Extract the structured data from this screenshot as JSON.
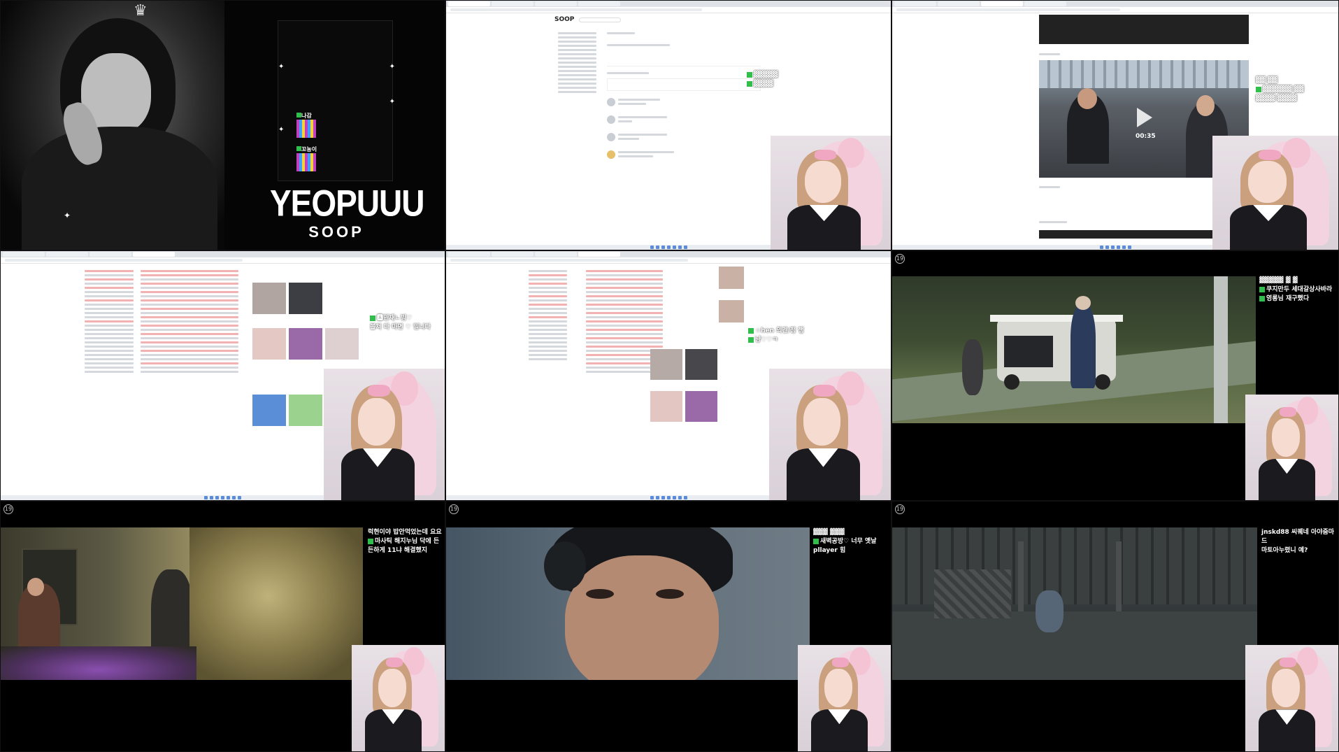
{
  "tile1": {
    "title": "YEOPUUU",
    "subtitle": "SOOP",
    "alert_names": [
      "나감",
      "꼬농이"
    ]
  },
  "tile2": {
    "logo": "SOOP"
  },
  "tile3": {
    "play_time": "00:35"
  },
  "tile4": {
    "chat": [
      {
        "badge": true,
        "text": "🅰민재ㄴ빔♡"
      },
      {
        "badge": false,
        "text": "볼쳐 다 마면 ♡ 밀니다"
      }
    ]
  },
  "tile5": {
    "chat": [
      {
        "badge": true,
        "text": "☆hen 의견/점 행"
      },
      {
        "badge": true,
        "text": "냥♡♡ㅋ"
      }
    ]
  },
  "tile6": {
    "badge": "19",
    "chat": [
      {
        "badge": true,
        "text": "쿠지만두 세대갈상사바라"
      },
      {
        "badge": true,
        "text": "영롱님 재구했다"
      }
    ]
  },
  "tile7": {
    "badge": "19",
    "chat": [
      {
        "badge": false,
        "text": "럭현이야 밥안먹었는데 요요"
      },
      {
        "badge": true,
        "text": "마사틱 해지누님 닥에 든"
      },
      {
        "badge": false,
        "text": "든하게 11냐 해결했지"
      }
    ]
  },
  "tile8": {
    "badge": "19",
    "chat": [
      {
        "badge": true,
        "text": "새벽공방♡ 너무 옛날"
      },
      {
        "badge": false,
        "text": "pllayer 힘"
      }
    ]
  },
  "tile9": {
    "badge": "19",
    "chat": [
      {
        "badge": false,
        "text": "jnskd88 씨퀘네 아야줌마"
      },
      {
        "badge": false,
        "text": "드"
      },
      {
        "badge": false,
        "text": "마토아누렸니 예?"
      }
    ]
  },
  "colors": {
    "chat_badge": "#2fbf4a",
    "soop_blue": "#2b6cf0",
    "chair_pink": "#f3d3df"
  },
  "icons": [
    "play-icon",
    "crown-icon",
    "sparkle-icon"
  ]
}
